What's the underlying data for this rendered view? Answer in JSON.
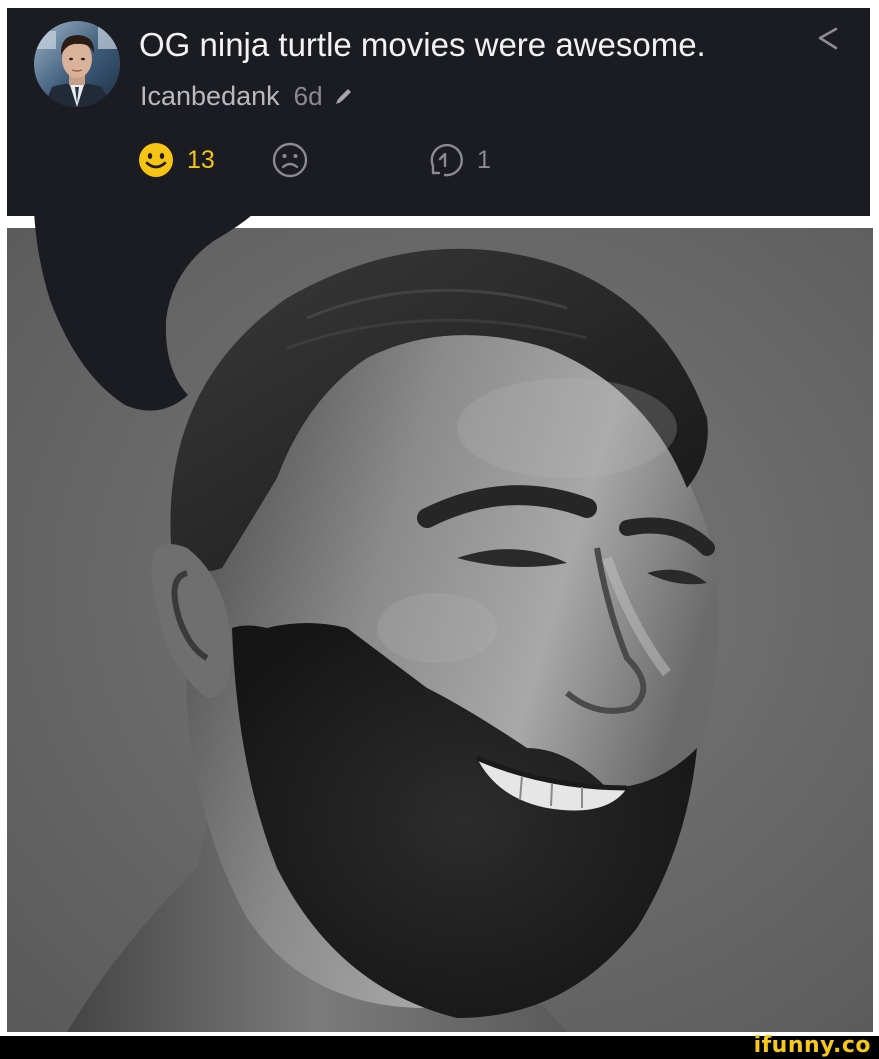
{
  "comment": {
    "text": "OG ninja turtle movies were awesome.",
    "username": "Icanbedank",
    "timestamp": "6d",
    "avatar_icon": "user-avatar-photo",
    "edited_icon": "pencil-icon",
    "share_icon": "share-icon",
    "smile_count": "13",
    "reply_count": "1",
    "colors": {
      "card_background": "#1b1c21",
      "smile_accent": "#f6c415",
      "text_primary": "#f2f2f2",
      "text_secondary": "#8a8a90"
    }
  },
  "meme": {
    "image_icon": "bearded-man-photo",
    "background": "#656565"
  },
  "footer": {
    "watermark": "ifunny.co",
    "watermark_color": "#f5c81a"
  }
}
